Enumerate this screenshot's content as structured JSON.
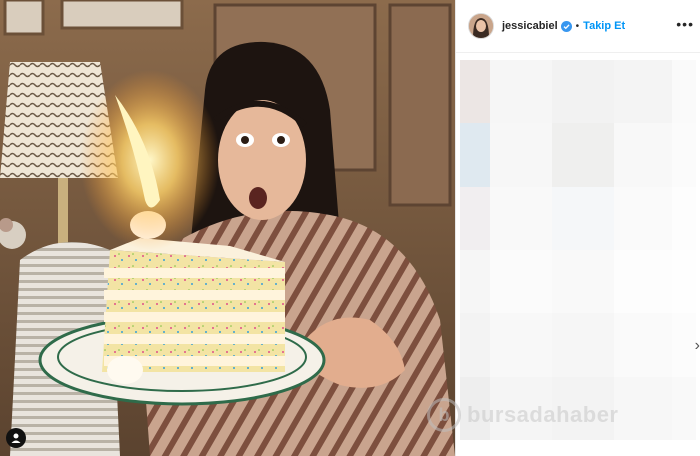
{
  "post": {
    "username": "jessicabiel",
    "separator": "•",
    "follow_label": "Takip Et",
    "more_label": "•••",
    "next_label": "›"
  },
  "watermark": {
    "logo_letter": "b",
    "text": "bursadahaber"
  },
  "icons": {
    "verified": "verified-badge-icon",
    "user_tag": "user-tag-icon",
    "more": "more-options-icon"
  },
  "colors": {
    "follow": "#0095f6",
    "verified": "#3897f0",
    "text": "#262626"
  }
}
